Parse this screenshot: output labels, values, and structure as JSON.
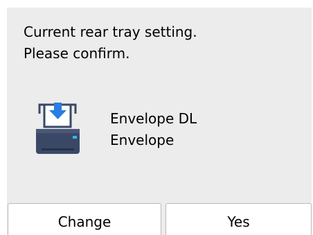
{
  "message": {
    "line1": "Current rear tray setting.",
    "line2": "Please confirm."
  },
  "paper": {
    "size": "Envelope DL",
    "type": "Envelope",
    "icon": "printer-rear-tray-icon"
  },
  "buttons": {
    "change_label": "Change",
    "yes_label": "Yes"
  },
  "colors": {
    "screen_background": "#ececec",
    "printer_body": "#3a4866",
    "arrow_accent": "#2a7de1",
    "status_light": "#32b8f0"
  }
}
